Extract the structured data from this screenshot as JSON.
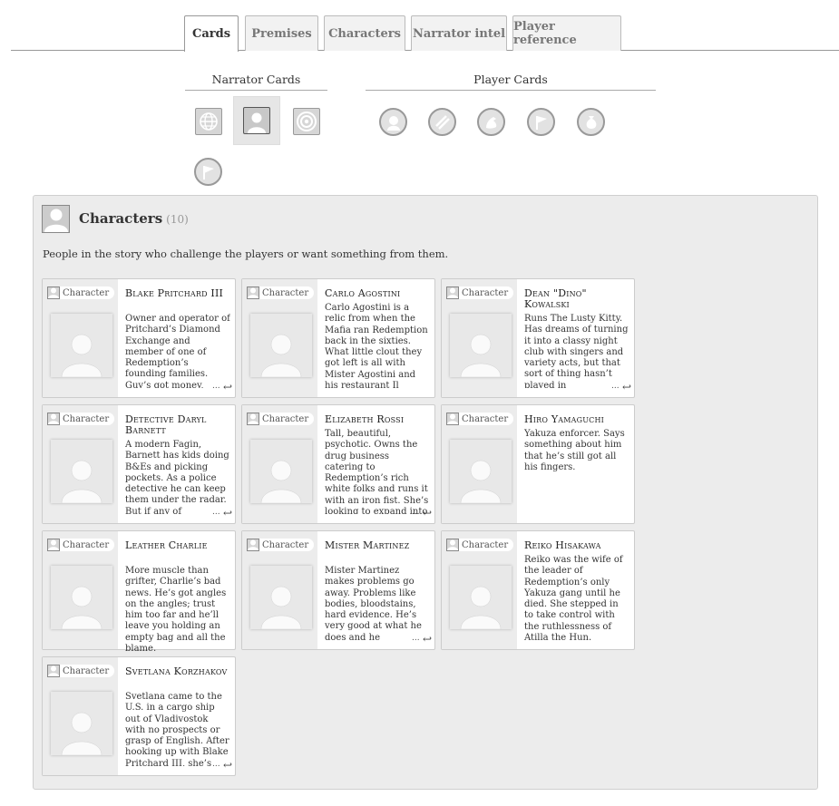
{
  "tabs": [
    {
      "label": "Cards",
      "active": true
    },
    {
      "label": "Premises",
      "active": false
    },
    {
      "label": "Characters",
      "active": false
    },
    {
      "label": "Narrator intel",
      "active": false
    },
    {
      "label": "Player reference",
      "active": false
    }
  ],
  "narrator_cards": {
    "label": "Narrator Cards",
    "icons": [
      "globe-card-icon",
      "person-card-icon",
      "target-card-icon",
      "flag-card-icon"
    ],
    "active_index": 1
  },
  "player_cards": {
    "label": "Player Cards",
    "icons": [
      "face-card-icon",
      "slash-card-icon",
      "muscle-card-icon",
      "flag-card-icon",
      "moneybag-card-icon"
    ]
  },
  "panel": {
    "icon": "person-icon",
    "title": "Characters",
    "count": "(10)",
    "description": "People in the story who challenge the players or want something from them."
  },
  "card_tag": "Character",
  "more_glyph": "...",
  "flip_icon": "flip-arrow-icon",
  "characters": [
    {
      "name": "Blake Pritchard III",
      "desc": "Owner and operator of Pritchard’s Diamond Exchange and member of one of Redemption’s founding families. Guy’s got money, bodyguards,",
      "truncated": true
    },
    {
      "name": "Carlo Agostini",
      "desc": "Carlo Agostini is a relic from when the Mafia ran Redemption back in the sixties. What little clout they got left is all with Mister Agostini and his restaurant Il Trovatore.",
      "truncated": false
    },
    {
      "name": "Dean \"Dino\" Kowalski",
      "desc": "Runs The Lusty Kitty. Has dreams of turning it into a classy night club with singers and variety acts, but that sort of thing hasn’t played in",
      "truncated": true
    },
    {
      "name": "Detective Daryl Barnett",
      "desc": "A modern Fagin, Barnett has kids doing B&Es and picking pockets. As a police detective he can keep them under the radar. But if any of",
      "truncated": true
    },
    {
      "name": "Elizabeth Rossi",
      "desc": "Tall, beautiful, psychotic. Owns the drug business catering to Redemption’s rich white folks and runs it with an iron fist. She’s looking to expand into poorer areas,",
      "truncated": true
    },
    {
      "name": "Hiro Yamaguchi",
      "desc": "Yakuza enforcer. Says something about him that he’s still got all his fingers.",
      "truncated": false
    },
    {
      "name": "Leather Charlie",
      "desc": "More muscle than grifter, Charlie’s bad news. He’s got angles on the angles; trust him too far and he’ll leave you holding an empty bag and all the blame.",
      "truncated": false
    },
    {
      "name": "Mister Martinez",
      "desc": "Mister Martinez makes problems go away. Problems like bodies, bloodstains, hard evidence. He’s very good at what he does and he",
      "truncated": true
    },
    {
      "name": "Reiko Hisakawa",
      "desc": "Reiko was the wife of the leader of Redemption’s only Yakuza gang until he died. She stepped in to take control with the ruthlessness of Atilla the Hun.",
      "truncated": false
    },
    {
      "name": "Svetlana Korzhakov",
      "desc": "Svetlana came to the U.S. in a cargo ship out of Vladivostok with no prospects or grasp of English. After hooking up with Blake Pritchard III, she’s",
      "truncated": true
    }
  ]
}
